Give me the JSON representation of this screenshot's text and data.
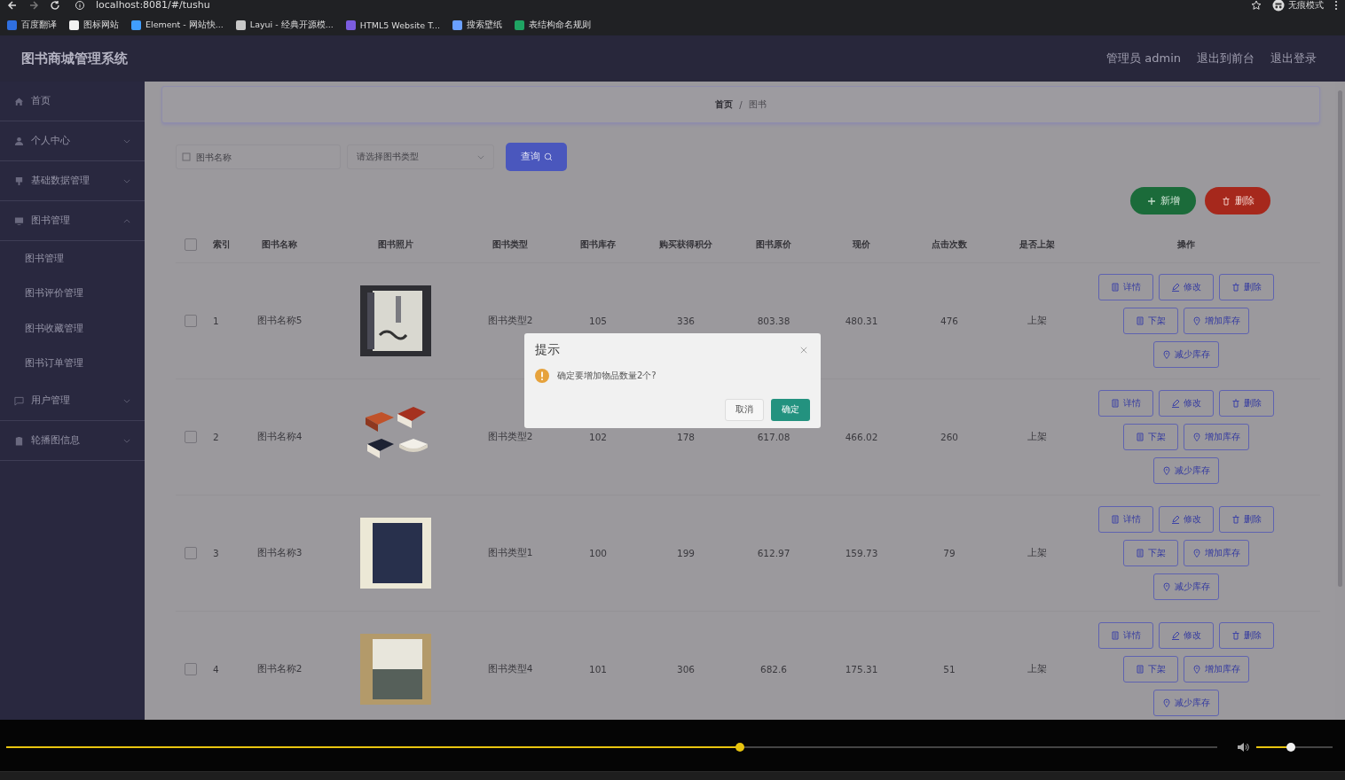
{
  "browser": {
    "url": "localhost:8081/#/tushu",
    "incognito_label": "无痕模式",
    "bookmarks": [
      {
        "label": "百度翻译",
        "color": "#2f6fe0"
      },
      {
        "label": "图标网站",
        "color": "#f2f2f2"
      },
      {
        "label": "Element - 网站快...",
        "color": "#409eff"
      },
      {
        "label": "Layui - 经典开源模...",
        "color": "#c8c8c8"
      },
      {
        "label": "HTML5 Website T...",
        "color": "#7b5ce0"
      },
      {
        "label": "搜索壁纸",
        "color": "#6aa0ff"
      },
      {
        "label": "表结构命名规则",
        "color": "#1fa463"
      }
    ]
  },
  "app": {
    "title": "图书商城管理系统",
    "header_links": [
      "管理员 admin",
      "退出到前台",
      "退出登录"
    ],
    "sidebar": [
      {
        "label": "首页",
        "kind": "home",
        "has_children": false
      },
      {
        "label": "个人中心",
        "kind": "user",
        "has_children": true,
        "expanded": false
      },
      {
        "label": "基础数据管理",
        "kind": "pin",
        "has_children": true,
        "expanded": false
      },
      {
        "label": "图书管理",
        "kind": "monitor",
        "has_children": true,
        "expanded": true,
        "children": [
          {
            "label": "图书管理"
          },
          {
            "label": "图书评价管理"
          },
          {
            "label": "图书收藏管理"
          },
          {
            "label": "图书订单管理"
          }
        ]
      },
      {
        "label": "用户管理",
        "kind": "chat",
        "has_children": true,
        "expanded": false
      },
      {
        "label": "轮播图信息",
        "kind": "clipboard",
        "has_children": true,
        "expanded": false
      }
    ],
    "breadcrumb": {
      "items": [
        "首页",
        "图书"
      ],
      "separator": "/"
    },
    "search": {
      "name_placeholder": "图书名称",
      "type_placeholder": "请选择图书类型",
      "button": "查询"
    },
    "add_button": "新增",
    "delete_button": "删除",
    "table": {
      "all_checked": false,
      "columns": [
        "索引",
        "图书名称",
        "图书照片",
        "图书类型",
        "图书库存",
        "购买获得积分",
        "图书原价",
        "现价",
        "点击次数",
        "是否上架",
        "操作"
      ],
      "rows": [
        {
          "checked": false,
          "index": "1",
          "name": "图书名称5",
          "type": "图书类型2",
          "stock": "105",
          "points": "336",
          "price": "803.38",
          "current": "480.31",
          "clicks": "476",
          "shelf": "上架",
          "actions": [
            [
              {
                "label": "详情",
                "kind": "doc"
              },
              {
                "label": "修改",
                "kind": "pen"
              },
              {
                "label": "删除",
                "kind": "trash"
              }
            ],
            [
              {
                "label": "下架",
                "kind": "doc"
              },
              {
                "label": "增加库存",
                "kind": "pin"
              }
            ],
            [
              {
                "label": "减少库存",
                "kind": "pin"
              }
            ]
          ]
        },
        {
          "checked": false,
          "index": "2",
          "name": "图书名称4",
          "type": "图书类型2",
          "stock": "102",
          "points": "178",
          "price": "617.08",
          "current": "466.02",
          "clicks": "260",
          "shelf": "上架",
          "actions": [
            [
              {
                "label": "详情",
                "kind": "doc"
              },
              {
                "label": "修改",
                "kind": "pen"
              },
              {
                "label": "删除",
                "kind": "trash"
              }
            ],
            [
              {
                "label": "下架",
                "kind": "doc"
              },
              {
                "label": "增加库存",
                "kind": "pin"
              }
            ],
            [
              {
                "label": "减少库存",
                "kind": "pin"
              }
            ]
          ]
        },
        {
          "checked": false,
          "index": "3",
          "name": "图书名称3",
          "type": "图书类型1",
          "stock": "100",
          "points": "199",
          "price": "612.97",
          "current": "159.73",
          "clicks": "79",
          "shelf": "上架",
          "actions": [
            [
              {
                "label": "详情",
                "kind": "doc"
              },
              {
                "label": "修改",
                "kind": "pen"
              },
              {
                "label": "删除",
                "kind": "trash"
              }
            ],
            [
              {
                "label": "下架",
                "kind": "doc"
              },
              {
                "label": "增加库存",
                "kind": "pin"
              }
            ],
            [
              {
                "label": "减少库存",
                "kind": "pin"
              }
            ]
          ]
        },
        {
          "checked": false,
          "index": "4",
          "name": "图书名称2",
          "type": "图书类型4",
          "stock": "101",
          "points": "306",
          "price": "682.6",
          "current": "175.31",
          "clicks": "51",
          "shelf": "上架",
          "actions": [
            [
              {
                "label": "详情",
                "kind": "doc"
              },
              {
                "label": "修改",
                "kind": "pen"
              },
              {
                "label": "删除",
                "kind": "trash"
              }
            ],
            [
              {
                "label": "下架",
                "kind": "doc"
              },
              {
                "label": "增加库存",
                "kind": "pin"
              }
            ],
            [
              {
                "label": "减少库存",
                "kind": "pin"
              }
            ]
          ]
        }
      ]
    }
  },
  "dialog": {
    "title": "提示",
    "message": "确定要增加物品数量2个?",
    "cancel": "取消",
    "confirm": "确定"
  },
  "player": {
    "progress": {
      "level": 0.606
    },
    "volume": {
      "level": 0.45
    }
  }
}
